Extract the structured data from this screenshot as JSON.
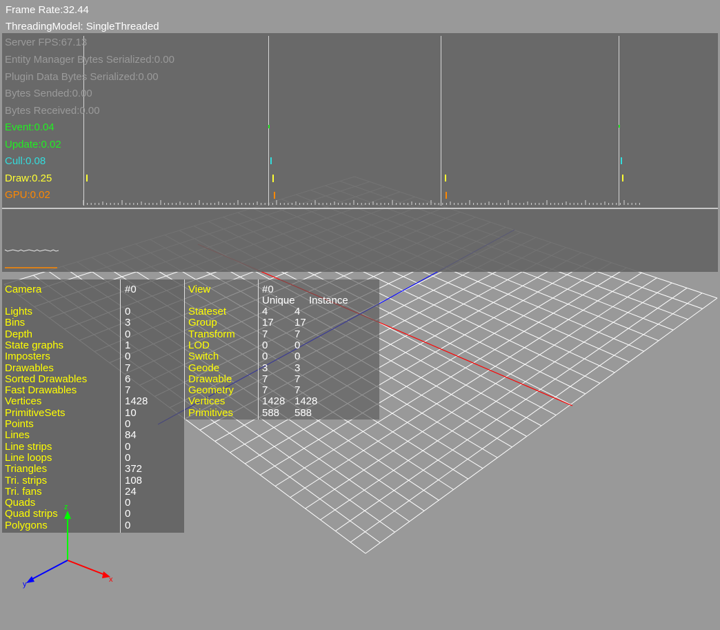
{
  "hud": {
    "frame_rate": "Frame Rate:32.44",
    "threading_model": "ThreadingModel: SingleThreaded"
  },
  "stats": {
    "server_fps": "Server FPS:67.13",
    "entity_bytes": "Entity Manager Bytes Serialized:0.00",
    "plugin_bytes": "Plugin Data Bytes Serialized:0.00",
    "bytes_sended": "Bytes Sended:0.00",
    "bytes_received": "Bytes Received:0.00",
    "event": "Event:0.04",
    "update": "Update:0.02",
    "cull": "Cull:0.08",
    "draw": "Draw:0.25",
    "gpu": "GPU:0.02"
  },
  "colors": {
    "background": "#999999",
    "grid": "#ffffff",
    "x_axis": "#ff0000",
    "y_axis": "#0000ff",
    "z_axis": "#00ff00",
    "event": "#22ee22",
    "update": "#22ee22",
    "cull": "#33dddd",
    "draw": "#ffff33",
    "gpu": "#ff8800",
    "label": "#ffff00"
  },
  "camera": {
    "heading_label": "Camera",
    "heading_value": "#0",
    "rows": [
      {
        "label": "Lights",
        "value": "0"
      },
      {
        "label": "Bins",
        "value": "3"
      },
      {
        "label": "Depth",
        "value": "0"
      },
      {
        "label": "State graphs",
        "value": "1"
      },
      {
        "label": "Imposters",
        "value": "0"
      },
      {
        "label": "Drawables",
        "value": "7"
      },
      {
        "label": "Sorted Drawables",
        "value": "6"
      },
      {
        "label": "Fast Drawables",
        "value": "7"
      },
      {
        "label": "Vertices",
        "value": "1428"
      },
      {
        "label": "PrimitiveSets",
        "value": "10"
      },
      {
        "label": "Points",
        "value": "0"
      },
      {
        "label": "Lines",
        "value": "84"
      },
      {
        "label": "Line strips",
        "value": "0"
      },
      {
        "label": "Line loops",
        "value": "0"
      },
      {
        "label": "Triangles",
        "value": "372"
      },
      {
        "label": "Tri. strips",
        "value": "108"
      },
      {
        "label": "Tri. fans",
        "value": "24"
      },
      {
        "label": "Quads",
        "value": "0"
      },
      {
        "label": "Quad strips",
        "value": "0"
      },
      {
        "label": "Polygons",
        "value": "0"
      }
    ]
  },
  "view": {
    "heading_label": "View",
    "heading_value": "#0",
    "col_unique": "Unique",
    "col_instance": "Instance",
    "rows": [
      {
        "label": "Stateset",
        "unique": "4",
        "instance": "4"
      },
      {
        "label": "Group",
        "unique": "17",
        "instance": "17"
      },
      {
        "label": "Transform",
        "unique": "7",
        "instance": "7"
      },
      {
        "label": "LOD",
        "unique": "0",
        "instance": "0"
      },
      {
        "label": "Switch",
        "unique": "0",
        "instance": "0"
      },
      {
        "label": "Geode",
        "unique": "3",
        "instance": "3"
      },
      {
        "label": "Drawable",
        "unique": "7",
        "instance": "7"
      },
      {
        "label": "Geometry",
        "unique": "7",
        "instance": "7"
      },
      {
        "label": "Vertices",
        "unique": "1428",
        "instance": "1428"
      },
      {
        "label": "Primitives",
        "unique": "588",
        "instance": "588"
      }
    ]
  },
  "axes_labels": {
    "x": "x",
    "y": "y",
    "z": "z"
  }
}
